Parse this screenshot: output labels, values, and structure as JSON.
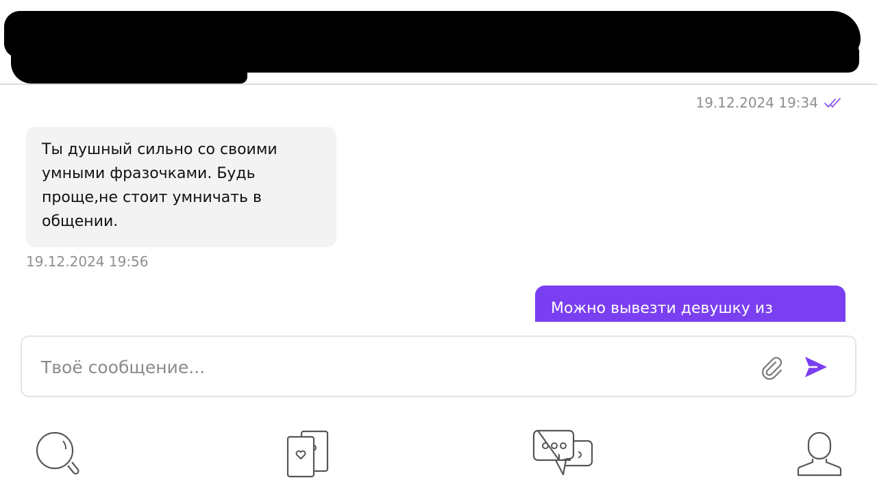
{
  "header": {
    "redacted": true
  },
  "messages": [
    {
      "direction": "sent",
      "timestamp": "19.12.2024 19:34",
      "status_icon": "double-check-icon"
    },
    {
      "direction": "received",
      "lines": [
        "Ты душный сильно со своими",
        "умными фразочками. Будь",
        "проще,не стоит умничать в",
        "общении."
      ],
      "timestamp": "19.12.2024 19:56"
    },
    {
      "direction": "sent",
      "text_visible": "Можно вывезти девушку из"
    }
  ],
  "composer": {
    "placeholder": "Твоё сообщение...",
    "attach_icon": "paperclip-icon",
    "send_icon": "send-icon"
  },
  "nav": {
    "items": [
      {
        "icon": "search-icon"
      },
      {
        "icon": "cards-icon"
      },
      {
        "icon": "chats-icon"
      },
      {
        "icon": "profile-icon"
      }
    ]
  },
  "colors": {
    "accent": "#7a3ff0",
    "incoming_bubble": "#f3f3f3",
    "timestamp_text": "#8e8e8e",
    "icon_stroke": "#555555"
  }
}
